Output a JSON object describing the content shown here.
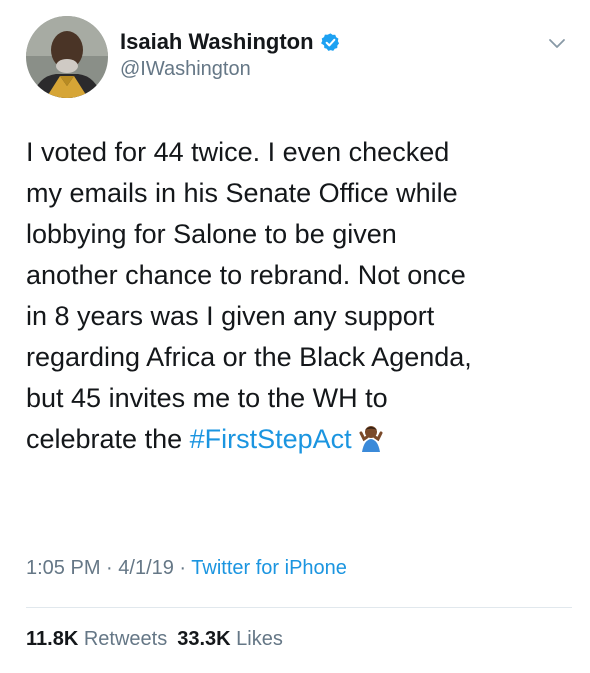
{
  "user": {
    "display_name": "Isaiah Washington",
    "handle": "@IWashington",
    "verified": true,
    "avatar_icon": "profile-photo"
  },
  "tweet": {
    "lines": [
      "I voted for 44 twice. I even checked",
      "my emails in his Senate Office while",
      "lobbying for Salone to be given",
      "another chance to rebrand. Not once",
      "in 8 years was I given any support",
      "regarding Africa or the Black Agenda,",
      "but 45 invites me to the WH to"
    ],
    "last_line_prefix": "celebrate the ",
    "hashtag": "#FirstStepAct",
    "emoji": "shrugging-person-emoji"
  },
  "meta": {
    "time": "1:05 PM",
    "separator": " · ",
    "date": "4/1/19",
    "source": "Twitter for iPhone"
  },
  "stats": {
    "retweets_count": "11.8K",
    "retweets_label": " Retweets",
    "likes_count": "33.3K",
    "likes_label": " Likes"
  },
  "colors": {
    "text": "#14171a",
    "secondary": "#657786",
    "link": "#1b95e0",
    "verified": "#1da1f2",
    "divider": "#e1e8ed"
  }
}
